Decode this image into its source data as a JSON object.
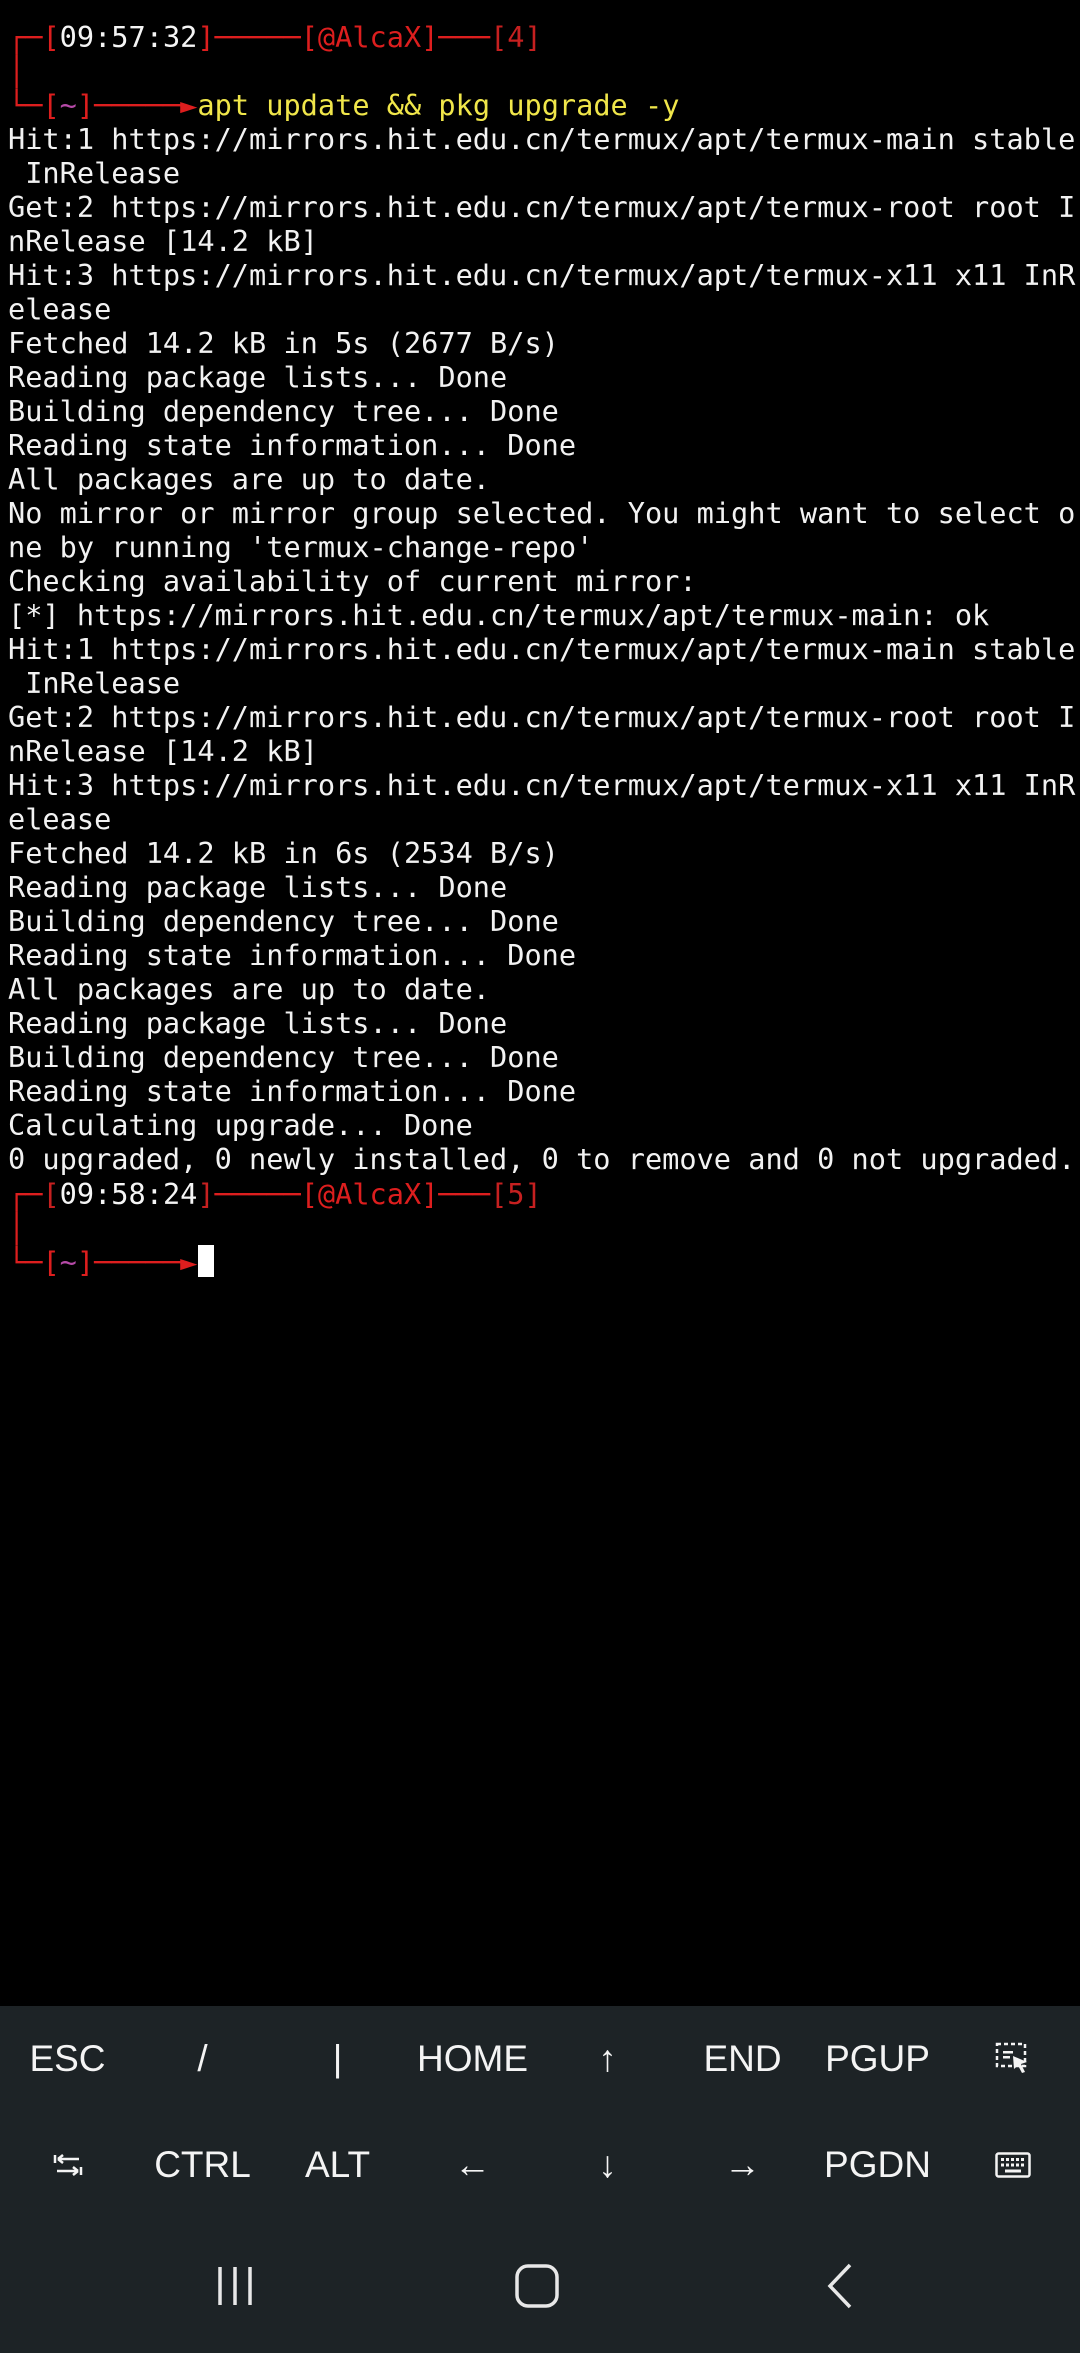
{
  "terminal": {
    "prompt1": {
      "corner_top": "┌─",
      "lbr": "[",
      "time": "09:57:32",
      "rbr": "]",
      "dash1": "─────",
      "user_lbr": "[",
      "user": "@AlcaX",
      "user_rbr": "]",
      "dash2": "───",
      "cnt_lbr": "[",
      "count": "4",
      "cnt_rbr": "]",
      "corner_bottom": "│",
      "corner_bottom2": "└─",
      "dir_lbr": "[",
      "dir": "~",
      "dir_rbr": "]",
      "arrow": "─────►",
      "command": "apt update && pkg upgrade -y"
    },
    "output": [
      "Hit:1 https://mirrors.hit.edu.cn/termux/apt/termux-main stable",
      " InRelease",
      "Get:2 https://mirrors.hit.edu.cn/termux/apt/termux-root root I",
      "nRelease [14.2 kB]",
      "Hit:3 https://mirrors.hit.edu.cn/termux/apt/termux-x11 x11 InR",
      "elease",
      "Fetched 14.2 kB in 5s (2677 B/s)",
      "Reading package lists... Done",
      "Building dependency tree... Done",
      "Reading state information... Done",
      "All packages are up to date.",
      "No mirror or mirror group selected. You might want to select o",
      "ne by running 'termux-change-repo'",
      "Checking availability of current mirror:",
      "[*] https://mirrors.hit.edu.cn/termux/apt/termux-main: ok",
      "Hit:1 https://mirrors.hit.edu.cn/termux/apt/termux-main stable",
      " InRelease",
      "Get:2 https://mirrors.hit.edu.cn/termux/apt/termux-root root I",
      "nRelease [14.2 kB]",
      "Hit:3 https://mirrors.hit.edu.cn/termux/apt/termux-x11 x11 InR",
      "elease",
      "Fetched 14.2 kB in 6s (2534 B/s)",
      "Reading package lists... Done",
      "Building dependency tree... Done",
      "Reading state information... Done",
      "All packages are up to date.",
      "Reading package lists... Done",
      "Building dependency tree... Done",
      "Reading state information... Done",
      "Calculating upgrade... Done",
      "0 upgraded, 0 newly installed, 0 to remove and 0 not upgraded."
    ],
    "prompt2": {
      "corner_top": "┌─",
      "lbr": "[",
      "time": "09:58:24",
      "rbr": "]",
      "dash1": "─────",
      "user_lbr": "[",
      "user": "@AlcaX",
      "user_rbr": "]",
      "dash2": "───",
      "cnt_lbr": "[",
      "count": "5",
      "cnt_rbr": "]",
      "corner_bottom": "│",
      "corner_bottom2": "└─",
      "dir_lbr": "[",
      "dir": "~",
      "dir_rbr": "]",
      "arrow": "─────►"
    }
  },
  "extra_keys": {
    "row1": [
      "ESC",
      "/",
      "|",
      "HOME",
      "↑",
      "END",
      "PGUP"
    ],
    "row1_last_icon": "select-text-icon",
    "row2_first_icon": "tab-arrows-icon",
    "row2": [
      "CTRL",
      "ALT",
      "←",
      "↓",
      "→",
      "PGDN"
    ],
    "row2_last_icon": "keyboard-icon"
  },
  "navbar": {
    "icons": [
      "recent-apps-icon",
      "home-icon",
      "back-icon"
    ]
  },
  "colors": {
    "background": "#000000",
    "bar_background": "#1d2326",
    "prompt_red": "#dd1e1e",
    "command_yellow": "#f0e64a",
    "dir_purple": "#b64aa8",
    "text": "#f2f2f2"
  }
}
